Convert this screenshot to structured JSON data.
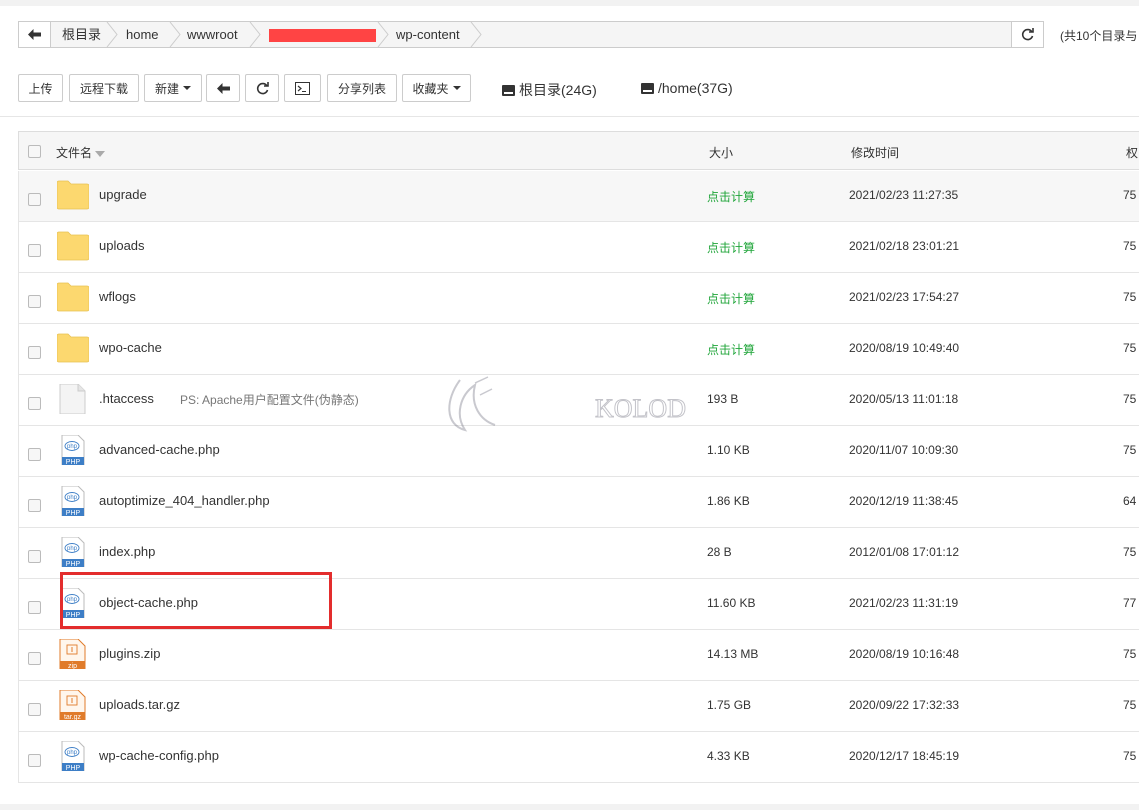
{
  "breadcrumb": {
    "items": [
      "根目录",
      "home",
      "wwwroot",
      "",
      "wp-content"
    ],
    "summary": "(共10个目录与"
  },
  "toolbar": {
    "upload": "上传",
    "remote_download": "远程下载",
    "new": "新建",
    "share_list": "分享列表",
    "favorites": "收藏夹",
    "disks": [
      "根目录(24G)",
      "/home(37G)"
    ]
  },
  "table": {
    "columns": [
      "文件名",
      "大小",
      "修改时间",
      "权"
    ],
    "rows": [
      {
        "name": "upgrade",
        "type": "folder",
        "size": "点击计算",
        "date": "2021/02/23 11:27:35",
        "perm": "75"
      },
      {
        "name": "uploads",
        "type": "folder",
        "size": "点击计算",
        "date": "2021/02/18 23:01:21",
        "perm": "75"
      },
      {
        "name": "wflogs",
        "type": "folder",
        "size": "点击计算",
        "date": "2021/02/23 17:54:27",
        "perm": "75"
      },
      {
        "name": "wpo-cache",
        "type": "folder",
        "size": "点击计算",
        "date": "2020/08/19 10:49:40",
        "perm": "75"
      },
      {
        "name": ".htaccess",
        "type": "file",
        "note": "PS: Apache用户配置文件(伪静态)",
        "size": "193 B",
        "date": "2020/05/13 11:01:18",
        "perm": "75"
      },
      {
        "name": "advanced-cache.php",
        "type": "php",
        "size": "1.10 KB",
        "date": "2020/11/07 10:09:30",
        "perm": "75"
      },
      {
        "name": "autoptimize_404_handler.php",
        "type": "php",
        "size": "1.86 KB",
        "date": "2020/12/19 11:38:45",
        "perm": "64"
      },
      {
        "name": "index.php",
        "type": "php",
        "size": "28 B",
        "date": "2012/01/08 17:01:12",
        "perm": "75"
      },
      {
        "name": "object-cache.php",
        "type": "php",
        "size": "11.60 KB",
        "date": "2021/02/23 11:31:19",
        "perm": "77"
      },
      {
        "name": "plugins.zip",
        "type": "zip",
        "size": "14.13 MB",
        "date": "2020/08/19 10:16:48",
        "perm": "75"
      },
      {
        "name": "uploads.tar.gz",
        "type": "targz",
        "size": "1.75 GB",
        "date": "2020/09/22 17:32:33",
        "perm": "75"
      },
      {
        "name": "wp-cache-config.php",
        "type": "php",
        "size": "4.33 KB",
        "date": "2020/12/17 18:45:19",
        "perm": "75"
      }
    ]
  },
  "icons": {
    "php_label": "PHP",
    "php_glyph": "php",
    "zip_label": "zip",
    "targz_label": "tar.gz"
  },
  "watermark": "KOLOD",
  "colors": {
    "accent_green": "#20a53a",
    "highlight_red": "#e32d2d",
    "folder_yellow": "#fcd86f",
    "php_blue": "#3d7ec6",
    "archive_orange": "#e07b2a"
  }
}
